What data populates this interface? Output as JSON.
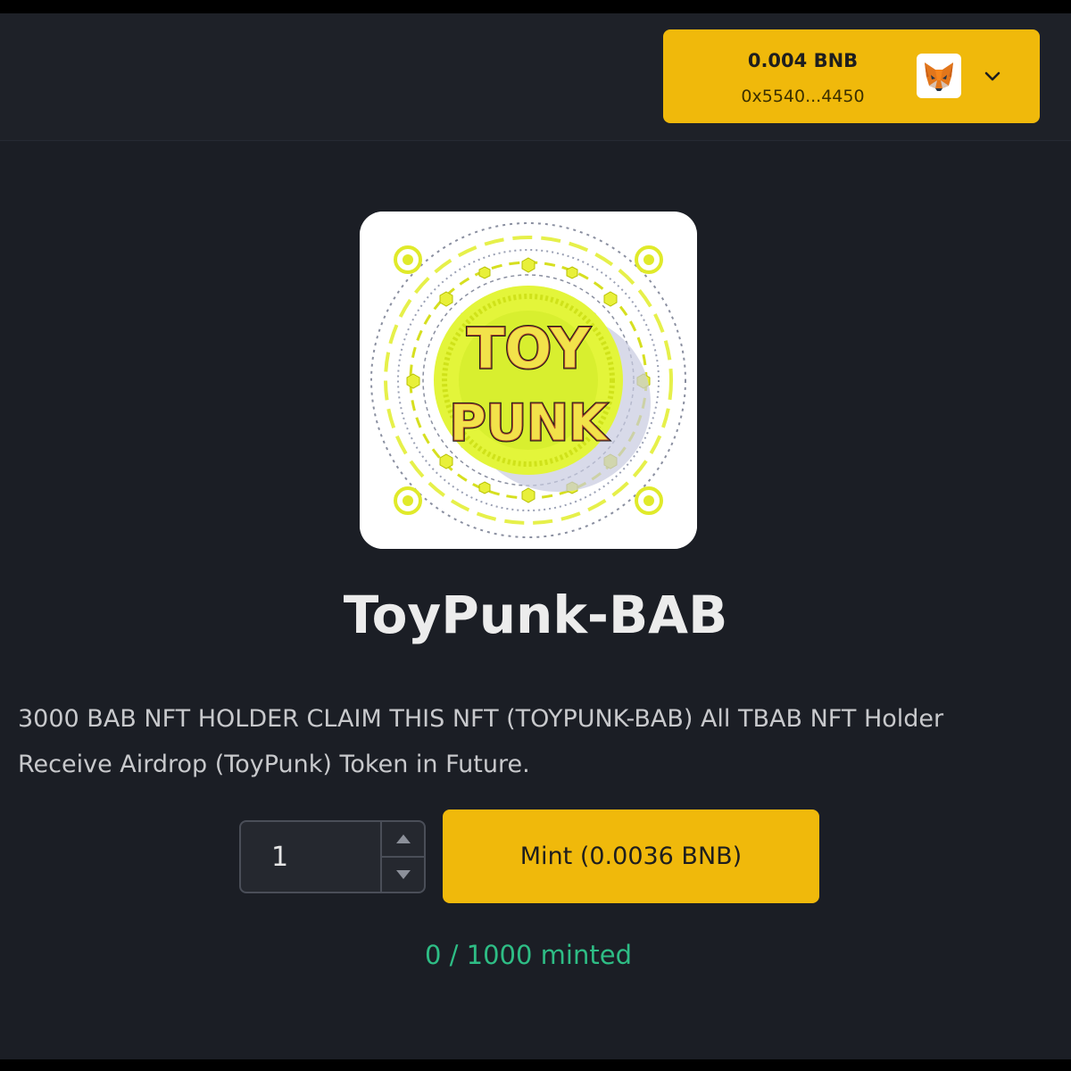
{
  "wallet": {
    "balance": "0.004 BNB",
    "address": "0x5540...4450",
    "wallet_icon": "metamask-fox-icon",
    "dropdown_icon": "chevron-down-icon"
  },
  "collection": {
    "logo_text_line1": "TOY",
    "logo_text_line2": "PUNK",
    "title": "ToyPunk-BAB",
    "description": "3000 BAB NFT HOLDER CLAIM THIS NFT (TOYPUNK-BAB) All TBAB NFT Holder Receive Airdrop (ToyPunk) Token in Future."
  },
  "mint": {
    "quantity": "1",
    "button_label": "Mint (0.0036 BNB)",
    "minted_status": "0 / 1000 minted"
  },
  "colors": {
    "background": "#1b1e25",
    "accent": "#f0b90b",
    "success": "#2ebd85"
  }
}
